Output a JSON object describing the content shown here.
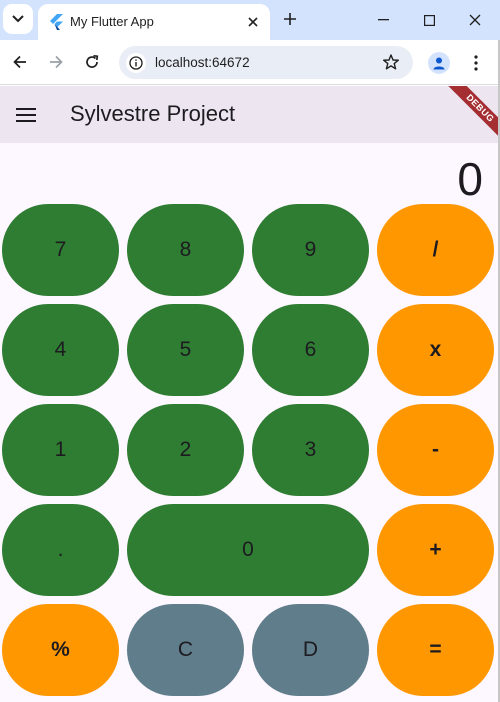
{
  "browser": {
    "tab_title": "My Flutter App",
    "url": "localhost:64672",
    "accent_color": "#d3e3fd"
  },
  "app": {
    "title": "Sylvestre Project",
    "debug_banner": "DEBUG",
    "display_value": "0",
    "colors": {
      "digit": "#2e7d32",
      "operator": "#ff9800",
      "control": "#607d8b",
      "background": "#fdf7ff",
      "appbar": "#ede6f1"
    },
    "keys": [
      [
        "7",
        "8",
        "9",
        "/"
      ],
      [
        "4",
        "5",
        "6",
        "x"
      ],
      [
        "1",
        "2",
        "3",
        "-"
      ],
      [
        ".",
        "0",
        "+"
      ],
      [
        "%",
        "C",
        "D",
        "="
      ]
    ]
  }
}
